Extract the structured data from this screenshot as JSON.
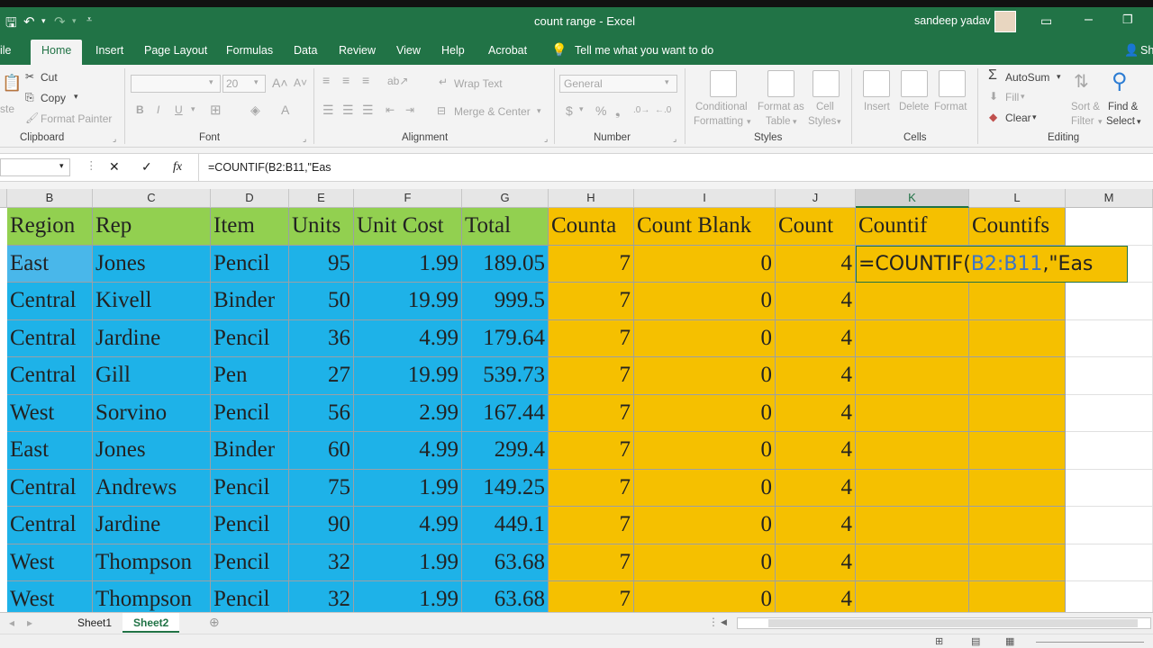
{
  "window": {
    "title": "count range  -  Excel",
    "user": "sandeep yadav"
  },
  "menu": {
    "file": "ile",
    "tabs": [
      "Home",
      "Insert",
      "Page Layout",
      "Formulas",
      "Data",
      "Review",
      "View",
      "Help",
      "Acrobat"
    ],
    "tell_me": "Tell me what you want to do",
    "share": "Sh"
  },
  "ribbon": {
    "clipboard": {
      "cut": "Cut",
      "copy": "Copy",
      "format_painter": "Format Painter",
      "paste_stub": "ste",
      "label": "Clipboard"
    },
    "font": {
      "size": "20",
      "label": "Font"
    },
    "alignment": {
      "wrap": "Wrap Text",
      "merge": "Merge & Center",
      "label": "Alignment"
    },
    "number": {
      "format": "General",
      "label": "Number"
    },
    "styles": {
      "conditional": "Conditional",
      "formatting": "Formatting",
      "format_as": "Format as",
      "table": "Table",
      "cell": "Cell",
      "styles_word": "Styles",
      "label": "Styles"
    },
    "cells": {
      "insert": "Insert",
      "delete": "Delete",
      "format": "Format",
      "label": "Cells"
    },
    "editing": {
      "autosum": "AutoSum",
      "fill": "Fill",
      "clear": "Clear",
      "sort": "Sort &",
      "filter": "Filter",
      "find": "Find &",
      "select": "Select",
      "label": "Editing"
    }
  },
  "formula_bar": {
    "formula": "=COUNTIF(B2:B11,\"Eas"
  },
  "columns": [
    "B",
    "C",
    "D",
    "E",
    "F",
    "G",
    "H",
    "I",
    "J",
    "K",
    "L",
    "M"
  ],
  "headers": [
    "Region",
    "Rep",
    "Item",
    "Units",
    "Unit Cost",
    "Total",
    "Counta",
    "Count Blank",
    "Count",
    "Countif",
    "Countifs"
  ],
  "rows": [
    [
      "East",
      "Jones",
      "Pencil",
      "95",
      "1.99",
      "189.05",
      "7",
      "0",
      "4"
    ],
    [
      "Central",
      "Kivell",
      "Binder",
      "50",
      "19.99",
      "999.5",
      "7",
      "0",
      "4"
    ],
    [
      "Central",
      "Jardine",
      "Pencil",
      "36",
      "4.99",
      "179.64",
      "7",
      "0",
      "4"
    ],
    [
      "Central",
      "Gill",
      "Pen",
      "27",
      "19.99",
      "539.73",
      "7",
      "0",
      "4"
    ],
    [
      "West",
      "Sorvino",
      "Pencil",
      "56",
      "2.99",
      "167.44",
      "7",
      "0",
      "4"
    ],
    [
      "East",
      "Jones",
      "Binder",
      "60",
      "4.99",
      "299.4",
      "7",
      "0",
      "4"
    ],
    [
      "Central",
      "Andrews",
      "Pencil",
      "75",
      "1.99",
      "149.25",
      "7",
      "0",
      "4"
    ],
    [
      "Central",
      "Jardine",
      "Pencil",
      "90",
      "4.99",
      "449.1",
      "7",
      "0",
      "4"
    ],
    [
      "West",
      "Thompson",
      "Pencil",
      "32",
      "1.99",
      "63.68",
      "7",
      "0",
      "4"
    ],
    [
      "West",
      "Thompson",
      "Pencil",
      "32",
      "1.99",
      "63.68",
      "7",
      "0",
      "4"
    ]
  ],
  "edit_cell": {
    "text": "=COUNTIF(",
    "range": "B2:B11",
    "rest": ",\"Eas"
  },
  "sheets": [
    "Sheet1",
    "Sheet2"
  ],
  "colors": {
    "excel_green": "#217346",
    "header_green": "#92d050",
    "data_blue": "#1eb2e8",
    "count_orange": "#f5c000"
  }
}
